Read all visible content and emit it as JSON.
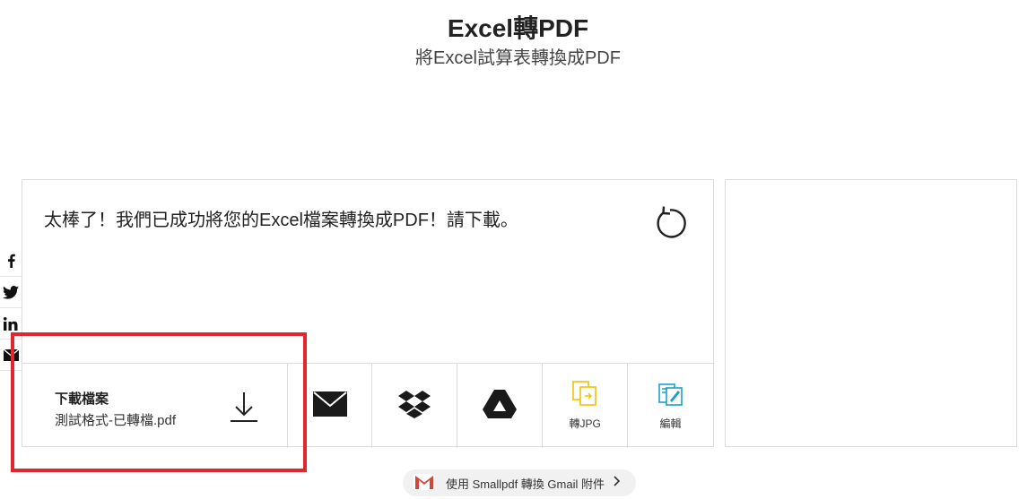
{
  "header": {
    "title": "Excel轉PDF",
    "subtitle": "將Excel試算表轉換成PDF"
  },
  "social": {
    "items": [
      {
        "name": "facebook",
        "glyph": "f"
      },
      {
        "name": "twitter",
        "glyph": "🐦"
      },
      {
        "name": "linkedin",
        "glyph": "in"
      },
      {
        "name": "email",
        "glyph": "✉"
      }
    ]
  },
  "result": {
    "message": "太棒了！我們已成功將您的Excel檔案轉換成PDF！請下載。",
    "retry_icon": "retry-icon"
  },
  "download": {
    "label": "下載檔案",
    "filename": "測試格式-已轉檔.pdf"
  },
  "tools": {
    "email_icon": "mail-icon",
    "dropbox_icon": "dropbox-icon",
    "drive_icon": "google-drive-icon",
    "jpg_label": "轉JPG",
    "edit_label": "編輯"
  },
  "gmail": {
    "label": "使用 Smallpdf 轉換 Gmail 附件"
  },
  "colors": {
    "highlight": "#e0262e",
    "jpg_accent": "#f2c200",
    "edit_accent": "#1aa0c8",
    "gmail_red": "#d44638"
  }
}
